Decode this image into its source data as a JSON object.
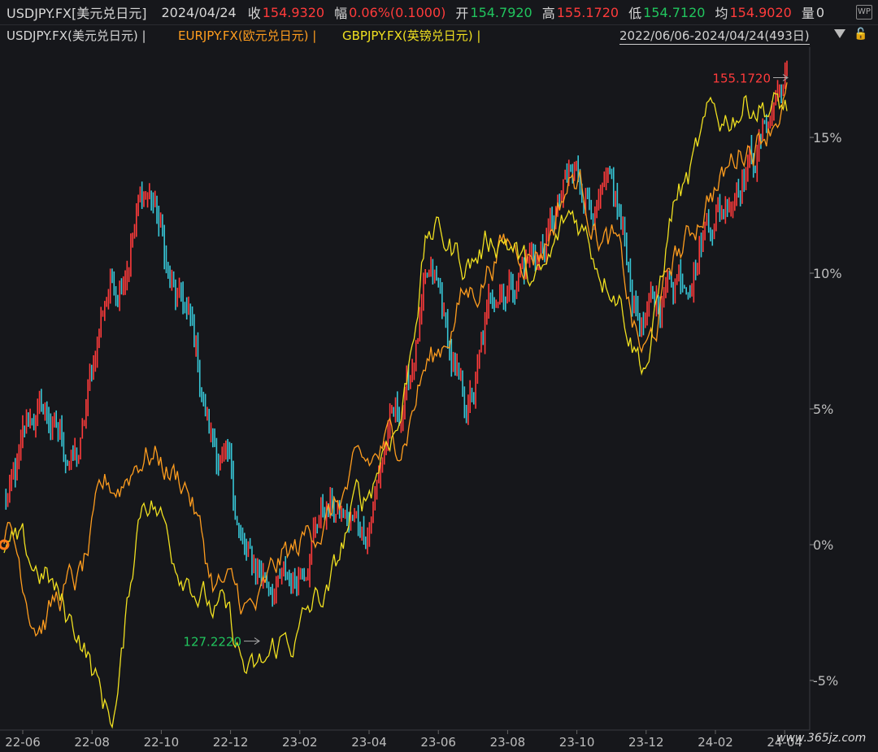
{
  "header": {
    "symbol": "USDJPY.FX[美元兑日元]",
    "date": "2024/04/24",
    "close_label": "收",
    "close_value": "154.9320",
    "change_label": "幅",
    "change_value": "0.06%(0.1000)",
    "open_label": "开",
    "open_value": "154.7920",
    "high_label": "高",
    "high_value": "155.1720",
    "low_label": "低",
    "low_value": "154.7120",
    "avg_label": "均",
    "avg_value": "154.9020",
    "vol_label": "量",
    "vol_value": "0",
    "wp_label": "WP"
  },
  "legend": {
    "usd": "USDJPY.FX(美元兑日元) |",
    "eur": "EURJPY.FX(欧元兑日元) |",
    "gbp": "GBPJPY.FX(英镑兑日元) |",
    "range": "2022/06/06-2024/04/24(493日)"
  },
  "colors": {
    "up": "#ff3b3b",
    "down": "#37c6d6",
    "eur": "#ff9d1e",
    "gbp": "#f0e020",
    "axis": "#bdbdbd"
  },
  "chart_data": {
    "type": "line",
    "y_unit": "%",
    "yticks": [
      "15%",
      "10%",
      "5%",
      "0%",
      "-5%"
    ],
    "ylim": [
      -6,
      18
    ],
    "xticks": [
      "22-06",
      "22-08",
      "22-10",
      "22-12",
      "23-02",
      "23-04",
      "23-06",
      "23-08",
      "23-10",
      "23-12",
      "24-02",
      "24-04"
    ],
    "annotations": {
      "max_label": "155.1720",
      "min_label": "127.2220"
    },
    "series": [
      {
        "name": "USDJPY.FX(美元兑日元)",
        "x": [
          "22-06",
          "22-07",
          "22-08",
          "22-09",
          "22-10",
          "22-11",
          "22-12",
          "23-01",
          "23-02",
          "23-03",
          "23-04",
          "23-05",
          "23-06",
          "23-07",
          "23-08",
          "23-09",
          "23-10",
          "23-11",
          "23-12",
          "24-01",
          "24-02",
          "24-03",
          "24-04"
        ],
        "values": [
          1.5,
          4.8,
          3.2,
          9.6,
          13.0,
          8.5,
          3.5,
          -1.0,
          -1.5,
          1.5,
          0.5,
          4.5,
          9.2,
          5.0,
          9.8,
          10.8,
          13.2,
          12.4,
          8.2,
          10.2,
          12.5,
          14.5,
          17.2
        ]
      },
      {
        "name": "EURJPY.FX(欧元兑日元)",
        "x": [
          "22-06",
          "22-07",
          "22-08",
          "22-09",
          "22-10",
          "22-11",
          "22-12",
          "23-01",
          "23-02",
          "23-03",
          "23-04",
          "23-05",
          "23-06",
          "23-07",
          "23-08",
          "23-09",
          "23-10",
          "23-11",
          "23-12",
          "24-01",
          "24-02",
          "24-03",
          "24-04"
        ],
        "values": [
          0.5,
          -2.5,
          -1.5,
          2.0,
          3.5,
          2.5,
          -1.5,
          -2.5,
          -0.5,
          1.0,
          2.5,
          3.8,
          6.8,
          9.2,
          11.0,
          11.0,
          13.5,
          11.2,
          7.0,
          10.8,
          13.3,
          15.0,
          16.5
        ]
      },
      {
        "name": "GBPJPY.FX(英镑兑日元)",
        "x": [
          "22-06",
          "22-07",
          "22-08",
          "22-09",
          "22-10",
          "22-11",
          "22-12",
          "23-01",
          "23-02",
          "23-03",
          "23-04",
          "23-05",
          "23-06",
          "23-07",
          "23-08",
          "23-09",
          "23-10",
          "23-11",
          "23-12",
          "24-01",
          "24-02",
          "24-03",
          "24-04"
        ],
        "values": [
          0.0,
          -1.0,
          -3.0,
          -6.2,
          2.0,
          -0.5,
          -2.5,
          -5.0,
          -3.5,
          -2.0,
          1.5,
          4.5,
          11.5,
          10.5,
          11.5,
          9.5,
          12.0,
          10.2,
          7.0,
          13.0,
          15.5,
          16.5,
          16.0
        ]
      }
    ]
  },
  "watermark": "www.365jz.com"
}
